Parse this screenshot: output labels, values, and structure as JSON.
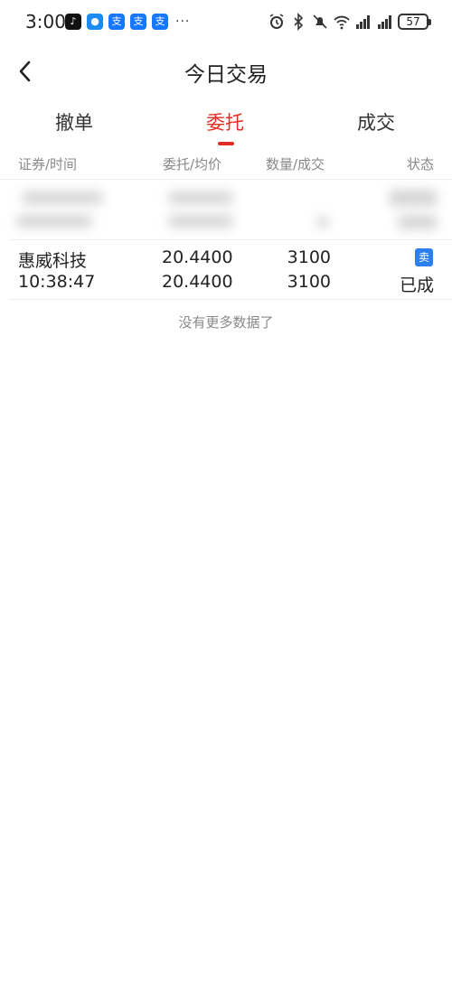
{
  "status_bar": {
    "time": "3:00",
    "more": "···",
    "battery": "57",
    "apps": [
      {
        "name": "tiktok-app-icon",
        "glyph": "♪"
      },
      {
        "name": "message-app-icon",
        "glyph": "●"
      },
      {
        "name": "alipay-app-icon",
        "glyph": "支"
      },
      {
        "name": "alipay-app-icon",
        "glyph": "支"
      },
      {
        "name": "alipay-app-icon",
        "glyph": "支"
      }
    ]
  },
  "header": {
    "title": "今日交易"
  },
  "tabs": [
    {
      "label": "撤单",
      "active": false
    },
    {
      "label": "委托",
      "active": true
    },
    {
      "label": "成交",
      "active": false
    }
  ],
  "columns": {
    "security_time": "证券/时间",
    "price_avg": "委托/均价",
    "qty_filled": "数量/成交",
    "status": "状态"
  },
  "orders": [
    {
      "name": "惠威科技",
      "time": "10:38:47",
      "order_price": "20.4400",
      "avg_price": "20.4400",
      "quantity": "3100",
      "filled": "3100",
      "side": "卖",
      "status": "已成"
    }
  ],
  "footer": {
    "no_more": "没有更多数据了"
  },
  "colors": {
    "accent": "#e02e24",
    "sell_badge": "#2d7ff0"
  }
}
